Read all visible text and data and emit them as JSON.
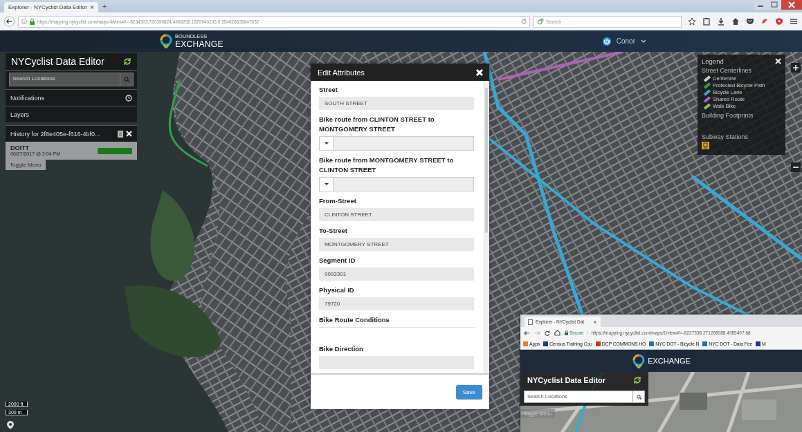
{
  "browser": {
    "tab_title": "Explorer - NYCyclist Data Editor",
    "new_tab": "+",
    "url": "https://mapping.nycyclist.com/maps/4/view#!=-8234503.720390824,4968292.1829940205,9.554628535647032",
    "search_placeholder": "Search"
  },
  "header": {
    "logo_small": "BOUNDLESS",
    "logo": "EXCHANGE",
    "user": "Conor"
  },
  "sidebar": {
    "title": "NYCyclist Data Editor",
    "search_placeholder": "Search Locations",
    "items": [
      {
        "label": "Notifications",
        "kind": "clock"
      },
      {
        "label": "Layers",
        "kind": "plain"
      },
      {
        "label": "History for 2f8e405e-f616-4bf0...",
        "kind": "history"
      }
    ],
    "history_entry": {
      "author": "DOITT",
      "time": "06/27/2017 @ 2:04 PM"
    },
    "toggle": "Toggle Menu"
  },
  "dialog": {
    "title": "Edit Attributes",
    "fields": [
      {
        "label": "Street",
        "kind": "text",
        "value": "SOUTH STREET"
      },
      {
        "label": "Bike route from CLINTON STREET to MONTGOMERY STREET",
        "kind": "select"
      },
      {
        "label": "Bike route from MONTGOMERY STREET to CLINTON STREET",
        "kind": "select"
      },
      {
        "label": "From-Street",
        "kind": "text",
        "value": "CLINTON STREET"
      },
      {
        "label": "To-Street",
        "kind": "text",
        "value": "MONTGOMERY STREET"
      },
      {
        "label": "Segment ID",
        "kind": "text",
        "value": "9003301"
      },
      {
        "label": "Physical ID",
        "kind": "text",
        "value": "79720"
      },
      {
        "label": "Bike Route Conditions",
        "kind": "group"
      },
      {
        "label": "Bike Direction",
        "kind": "text"
      }
    ],
    "save": "Save"
  },
  "legend": {
    "title": "Legend",
    "sections": [
      {
        "title": "Street Centerlines",
        "items": [
          {
            "label": "Centerline",
            "color": "#cfcfcf"
          },
          {
            "label": "Protected Bicycle Path",
            "color": "#2f9e4c"
          },
          {
            "label": "Bicycle Lane",
            "color": "#37a8d4"
          },
          {
            "label": "Shared Route",
            "color": "#b061b5"
          },
          {
            "label": "Walk Bike",
            "color": "#8cc04a"
          }
        ]
      },
      {
        "title": "Building Footprints"
      },
      {
        "title": "Subway Stations",
        "kind": "subway"
      }
    ]
  },
  "map": {
    "scale": [
      "2000 ft",
      "300 m"
    ]
  },
  "inset": {
    "tab_title": "Explorer - NYCyclist Dat",
    "secure": "Secure",
    "url": "https://mapping.nycyclist.com/maps/1/view#!=-8227338.271268088,4985497.68",
    "bookmarks": [
      "Apps",
      "Census Training Cou",
      "DCP COMMONS HO",
      "NYC DOT - Bicycle N",
      "NYC DOT - Data Fee",
      "M"
    ],
    "logo": "EXCHANGE",
    "title": "NYCyclist Data Editor",
    "search_placeholder": "Search Locations",
    "toggle": "Toggle Menu"
  }
}
